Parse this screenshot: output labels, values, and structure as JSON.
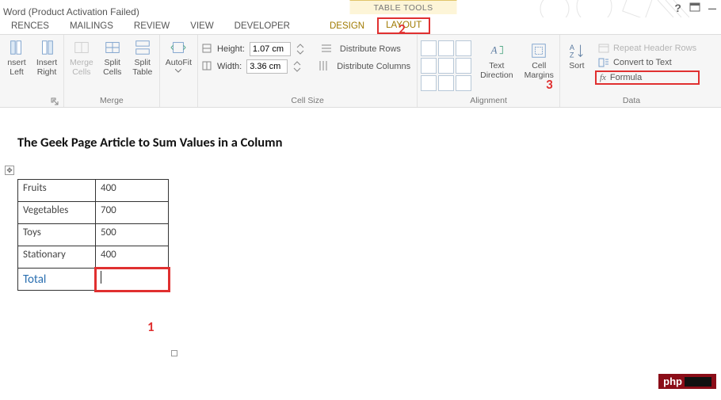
{
  "title_suffix": "Word (Product Activation Failed)",
  "contextual_tab_title": "TABLE TOOLS",
  "tabs": {
    "references": "RENCES",
    "mailings": "MAILINGS",
    "review": "REVIEW",
    "view": "VIEW",
    "developer": "DEVELOPER",
    "design": "DESIGN",
    "layout": "LAYOUT"
  },
  "annotations": {
    "one": "1",
    "two": "2",
    "three": "3"
  },
  "ribbon": {
    "rows_cols": {
      "insert_left": "nsert\nLeft",
      "insert_right": "Insert\nRight"
    },
    "merge": {
      "label": "Merge",
      "merge_cells": "Merge\nCells",
      "split_cells": "Split\nCells",
      "split_table": "Split\nTable"
    },
    "autofit": "AutoFit",
    "cell_size": {
      "label": "Cell Size",
      "height_label": "Height:",
      "width_label": "Width:",
      "height_value": "1.07 cm",
      "width_value": "3.36 cm",
      "distribute_rows": "Distribute Rows",
      "distribute_cols": "Distribute Columns"
    },
    "alignment": {
      "label": "Alignment",
      "text_direction": "Text\nDirection",
      "cell_margins": "Cell\nMargins"
    },
    "sort": "Sort",
    "data": {
      "label": "Data",
      "repeat_header": "Repeat Header Rows",
      "convert_text": "Convert to Text",
      "formula": "Formula"
    }
  },
  "document": {
    "heading": "The Geek Page Article to Sum Values in a Column",
    "table_rows": [
      {
        "label": "Fruits",
        "value": "400"
      },
      {
        "label": "Vegetables",
        "value": "700"
      },
      {
        "label": "Toys",
        "value": "500"
      },
      {
        "label": "Stationary",
        "value": "400"
      }
    ],
    "total_label": "Total"
  },
  "watermark": "php"
}
